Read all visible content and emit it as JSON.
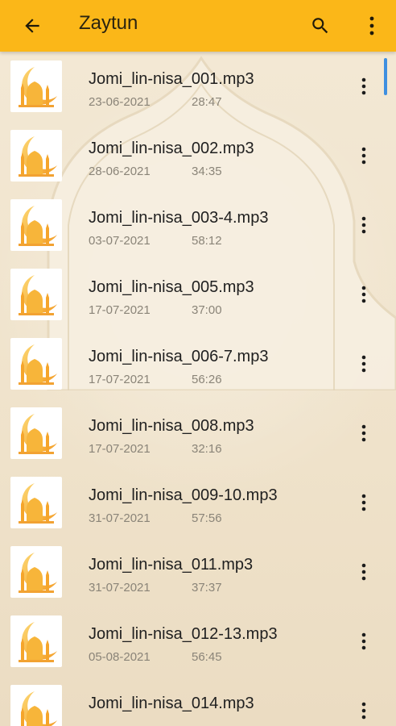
{
  "appbar": {
    "title": "Zaytun",
    "background": "#fbb718"
  },
  "icons": {
    "back": "arrow-back-icon",
    "search": "search-icon",
    "menu": "more-vert-icon",
    "thumbnail": "mosque-crescent-icon"
  },
  "files": [
    {
      "name": "Jomi_lin-nisa_001.mp3",
      "date": "23-06-2021",
      "duration": "28:47"
    },
    {
      "name": "Jomi_lin-nisa_002.mp3",
      "date": "28-06-2021",
      "duration": "34:35"
    },
    {
      "name": "Jomi_lin-nisa_003-4.mp3",
      "date": "03-07-2021",
      "duration": "58:12"
    },
    {
      "name": "Jomi_lin-nisa_005.mp3",
      "date": "17-07-2021",
      "duration": "37:00"
    },
    {
      "name": "Jomi_lin-nisa_006-7.mp3",
      "date": "17-07-2021",
      "duration": "56:26"
    },
    {
      "name": "Jomi_lin-nisa_008.mp3",
      "date": "17-07-2021",
      "duration": "32:16"
    },
    {
      "name": "Jomi_lin-nisa_009-10.mp3",
      "date": "31-07-2021",
      "duration": "57:56"
    },
    {
      "name": "Jomi_lin-nisa_011.mp3",
      "date": "31-07-2021",
      "duration": "37:37"
    },
    {
      "name": "Jomi_lin-nisa_012-13.mp3",
      "date": "05-08-2021",
      "duration": "56:45"
    },
    {
      "name": "Jomi_lin-nisa_014.mp3",
      "date": "",
      "duration": ""
    }
  ]
}
